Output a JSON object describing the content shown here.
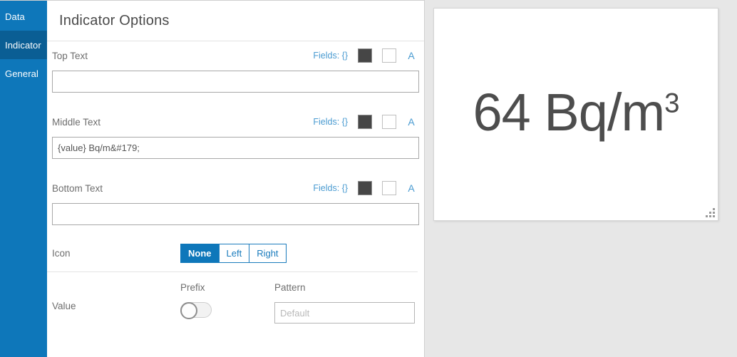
{
  "sidebar": {
    "items": [
      {
        "label": "Data",
        "active": false
      },
      {
        "label": "Indicator",
        "active": true
      },
      {
        "label": "General",
        "active": false
      }
    ]
  },
  "header": {
    "title": "Indicator Options"
  },
  "fields_controls": {
    "fields_link": "Fields: {}",
    "text_color_swatch": "#464646",
    "background_color_swatch": "#ffffff",
    "font_label": "A"
  },
  "form": {
    "top_text": {
      "label": "Top Text",
      "value": "",
      "placeholder": ""
    },
    "middle_text": {
      "label": "Middle Text",
      "value": "{value} Bq/m&#179;",
      "placeholder": ""
    },
    "bottom_text": {
      "label": "Bottom Text",
      "value": "",
      "placeholder": ""
    },
    "icon": {
      "label": "Icon",
      "options": [
        {
          "label": "None",
          "active": true
        },
        {
          "label": "Left",
          "active": false
        },
        {
          "label": "Right",
          "active": false
        }
      ]
    },
    "value": {
      "label": "Value",
      "prefix": {
        "label": "Prefix",
        "enabled": false
      },
      "pattern": {
        "label": "Pattern",
        "value": "",
        "placeholder": "Default"
      }
    }
  },
  "preview": {
    "number": "64 Bq/m",
    "superscript": "3"
  },
  "colors": {
    "accent_blue": "#0e77ba",
    "accent_blue_dark": "#0a5e94",
    "link_blue": "#4a9bd1",
    "preview_bg": "#e7e7e7",
    "text_gray": "#4d4d4d"
  }
}
